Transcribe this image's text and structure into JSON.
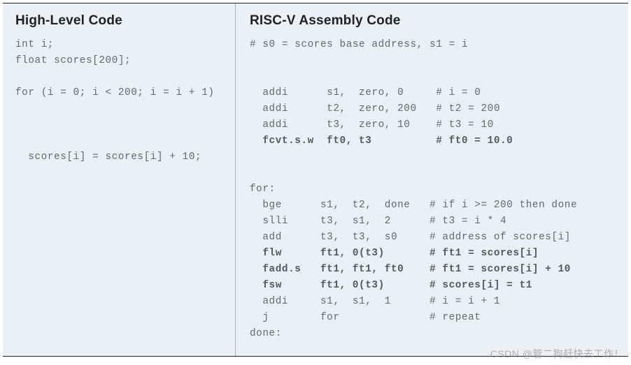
{
  "left": {
    "title": "High-Level Code",
    "code": "int i;\nfloat scores[200];\n\nfor (i = 0; i < 200; i = i + 1)\n\n\n\n  scores[i] = scores[i] + 10;"
  },
  "right": {
    "title": "RISC-V Assembly Code",
    "code": "# s0 = scores base address, s1 = i\n\n\n  addi      s1,  zero, 0     # i = 0\n  addi      t2,  zero, 200   # t2 = 200\n  addi      t3,  zero, 10    # t3 = 10\n  <b>fcvt.s.w  ft0, t3          # ft0 = 10.0</b>\n\n\nfor:\n  bge      s1,  t2,  done   # if i >= 200 then done\n  slli     t3,  s1,  2      # t3 = i * 4\n  add      t3,  t3,  s0     # address of scores[i]\n  <b>flw      ft1, 0(t3)       # ft1 = scores[i]</b>\n  <b>fadd.s   ft1, ft1, ft0    # ft1 = scores[i] + 10</b>\n  <b>fsw      ft1, 0(t3)       # scores[i] = t1</b>\n  addi     s1,  s1,  1      # i = i + 1\n  j        for              # repeat\ndone:"
  },
  "watermark": "CSDN @管二狗赶快去工作！"
}
